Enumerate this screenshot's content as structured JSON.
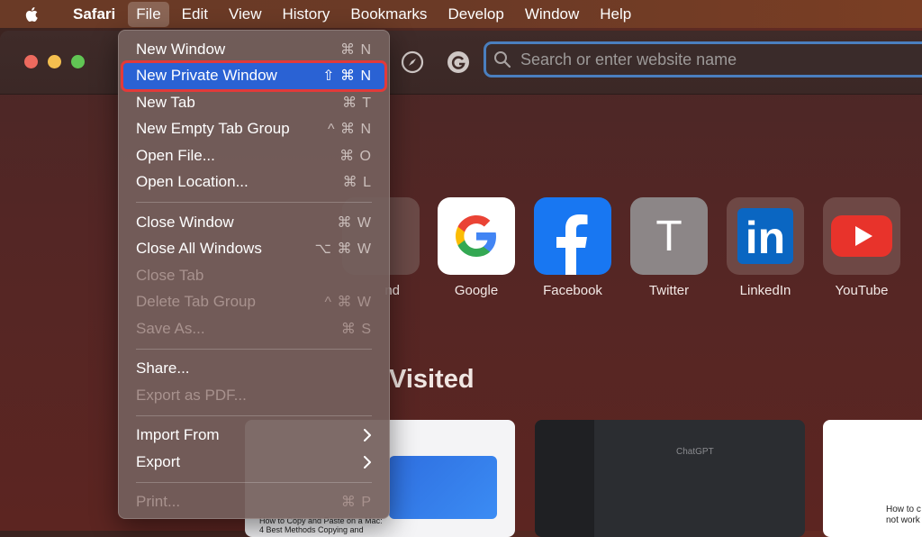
{
  "menubar": {
    "items": [
      {
        "label": "Safari",
        "bold": true
      },
      {
        "label": "File",
        "active": true
      },
      {
        "label": "Edit"
      },
      {
        "label": "View"
      },
      {
        "label": "History"
      },
      {
        "label": "Bookmarks"
      },
      {
        "label": "Develop"
      },
      {
        "label": "Window"
      },
      {
        "label": "Help"
      }
    ]
  },
  "toolbar": {
    "search_placeholder": "Search or enter website name"
  },
  "file_menu": {
    "groups": [
      [
        {
          "label": "New Window",
          "shortcut": "⌘ N"
        },
        {
          "label": "New Private Window",
          "shortcut": "⇧ ⌘ N",
          "highlighted": true
        },
        {
          "label": "New Tab",
          "shortcut": "⌘ T"
        },
        {
          "label": "New Empty Tab Group",
          "shortcut": "^ ⌘ N"
        },
        {
          "label": "Open File...",
          "shortcut": "⌘ O"
        },
        {
          "label": "Open Location...",
          "shortcut": "⌘ L"
        }
      ],
      [
        {
          "label": "Close Window",
          "shortcut": "⌘ W"
        },
        {
          "label": "Close All Windows",
          "shortcut": "⌥ ⌘ W"
        },
        {
          "label": "Close Tab",
          "shortcut": "",
          "disabled": true
        },
        {
          "label": "Delete Tab Group",
          "shortcut": "^ ⌘ W",
          "disabled": true
        },
        {
          "label": "Save As...",
          "shortcut": "⌘ S",
          "disabled": true
        }
      ],
      [
        {
          "label": "Share...",
          "shortcut": ""
        },
        {
          "label": "Export as PDF...",
          "shortcut": "",
          "disabled": true
        }
      ],
      [
        {
          "label": "Import From",
          "submenu": true
        },
        {
          "label": "Export",
          "submenu": true
        }
      ],
      [
        {
          "label": "Print...",
          "shortcut": "⌘ P",
          "disabled": true
        }
      ]
    ]
  },
  "favorites": {
    "partial_label": "nd",
    "items": [
      {
        "label": "Google",
        "icon": "google-icon"
      },
      {
        "label": "Facebook",
        "icon": "facebook-icon"
      },
      {
        "label": "Twitter",
        "icon": "twitter-letter-icon",
        "letter": "T"
      },
      {
        "label": "LinkedIn",
        "icon": "linkedin-icon",
        "letter": "in"
      },
      {
        "label": "YouTube",
        "icon": "youtube-icon"
      }
    ]
  },
  "frequently_visited": {
    "title": "Visited",
    "thumb1_caption": "How to Copy and Paste on a Mac: 4 Best Methods Copying and",
    "thumb2_caption": "ChatGPT",
    "thumb3_caption": "How to c not work"
  }
}
